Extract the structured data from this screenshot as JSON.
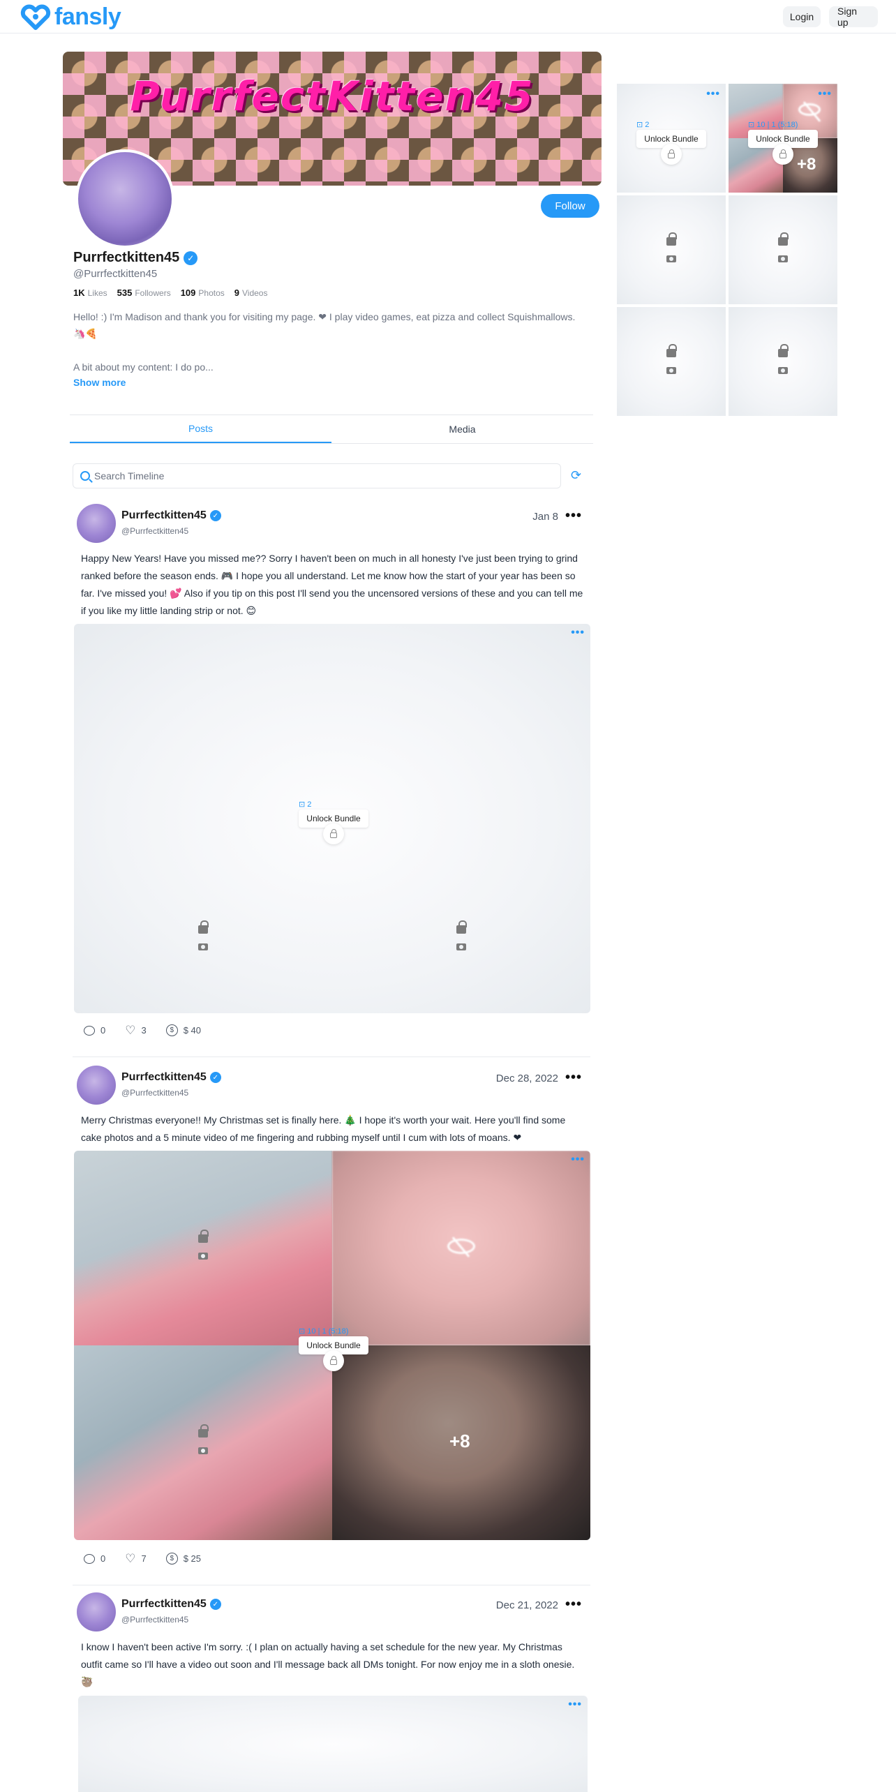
{
  "nav": {
    "logo": "fansly",
    "login": "Login",
    "signup": "Sign up"
  },
  "profile": {
    "banner_text": "PurrfectKitten45",
    "follow": "Follow",
    "name": "Purrfectkitten45",
    "handle": "@Purrfectkitten45",
    "stats": [
      {
        "value": "1K",
        "label": "Likes"
      },
      {
        "value": "535",
        "label": "Followers"
      },
      {
        "value": "109",
        "label": "Photos"
      },
      {
        "value": "9",
        "label": "Videos"
      }
    ],
    "bio_line1": "Hello! :) I'm Madison and thank you for visiting my page. ❤ I play video games, eat pizza and collect Squishmallows. 🦄🍕",
    "bio_line2": "A bit about my content: I do po...",
    "show_more": "Show more"
  },
  "tabs": [
    "Posts",
    "Media"
  ],
  "search": {
    "placeholder": "Search Timeline"
  },
  "posts": [
    {
      "name": "Purrfectkitten45",
      "handle": "@Purrfectkitten45",
      "date": "Jan 8",
      "text": "Happy New Years! Have you missed me?? Sorry I haven't been on much in all honesty I've just been trying to grind ranked before the season ends. 🎮 I hope you all understand. Let me know how the start of your year has been so far. I've missed you! 💕 Also if you tip on this post I'll send you the uncensored versions of these and you can tell me if you like my little landing strip or not. 😊",
      "bundle_count": "2",
      "bundle_label": "Unlock Bundle",
      "comments": "0",
      "likes": "3",
      "tips": "$ 40"
    },
    {
      "name": "Purrfectkitten45",
      "handle": "@Purrfectkitten45",
      "date": "Dec 28, 2022",
      "text": "Merry Christmas everyone!! My Christmas set is finally here. 🎄 I hope it's worth your wait. Here you'll find some cake photos and a 5 minute video of me fingering and rubbing myself until I cum with lots of moans. ❤",
      "bundle_count": "10 | 1 (5:18)",
      "bundle_label": "Unlock Bundle",
      "more_count": "+8",
      "comments": "0",
      "likes": "7",
      "tips": "$ 25"
    },
    {
      "name": "Purrfectkitten45",
      "handle": "@Purrfectkitten45",
      "date": "Dec 21, 2022",
      "text": "I know I haven't been active I'm sorry. :( I plan on actually having a set schedule for the new year. My Christmas outfit came so I'll have a video out soon and I'll message back all DMs tonight. For now enjoy me in a sloth onesie. 🦥"
    }
  ],
  "sidebar": {
    "tile1_count": "2",
    "tile1_label": "Unlock Bundle",
    "tile2_count": "10 | 1 (5:18)",
    "tile2_label": "Unlock Bundle",
    "tile2_more": "+8"
  },
  "colors": {
    "accent": "#2699f7",
    "banner_text": "#ff1fa8"
  },
  "icons": [
    "fansly-logo-icon",
    "verified-icon",
    "search-icon",
    "refresh-icon",
    "more-icon",
    "lock-icon",
    "camera-icon",
    "comment-icon",
    "heart-icon",
    "tip-icon",
    "hidden-eye-icon"
  ]
}
